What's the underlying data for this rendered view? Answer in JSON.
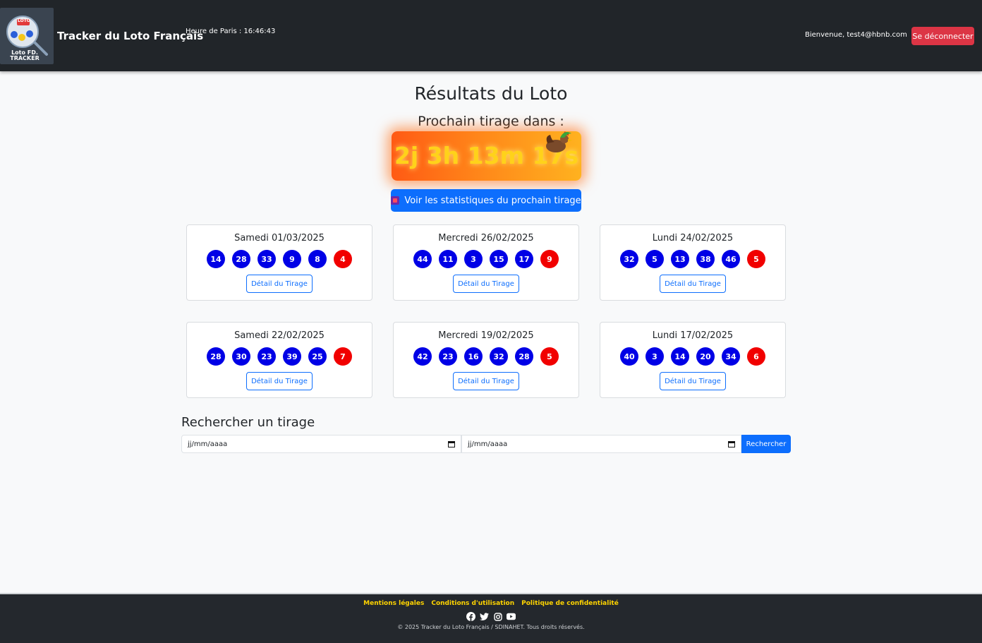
{
  "header": {
    "logo_text_top": "LOTO",
    "logo_text_bottom": "Loto FD. TRACKER",
    "brand": "Tracker du Loto Français",
    "clock": "Heure de Paris : 16:46:43",
    "welcome": "Bienvenue, test4@hbnb.com",
    "logout_label": "Se déconnecter"
  },
  "main": {
    "title": "Résultats du Loto",
    "subtitle": "Prochain tirage dans :",
    "countdown": "2j 3h 13m 17s",
    "stats_button": "Voir les statistiques du prochain tirage"
  },
  "draws": [
    {
      "date": "Samedi 01/03/2025",
      "numbers": [
        "14",
        "28",
        "33",
        "9",
        "8"
      ],
      "chance": "4",
      "detail_label": "Détail du Tirage"
    },
    {
      "date": "Mercredi 26/02/2025",
      "numbers": [
        "44",
        "11",
        "3",
        "15",
        "17"
      ],
      "chance": "9",
      "detail_label": "Détail du Tirage"
    },
    {
      "date": "Lundi 24/02/2025",
      "numbers": [
        "32",
        "5",
        "13",
        "38",
        "46"
      ],
      "chance": "5",
      "detail_label": "Détail du Tirage"
    },
    {
      "date": "Samedi 22/02/2025",
      "numbers": [
        "28",
        "30",
        "23",
        "39",
        "25"
      ],
      "chance": "7",
      "detail_label": "Détail du Tirage"
    },
    {
      "date": "Mercredi 19/02/2025",
      "numbers": [
        "42",
        "23",
        "16",
        "32",
        "28"
      ],
      "chance": "5",
      "detail_label": "Détail du Tirage"
    },
    {
      "date": "Lundi 17/02/2025",
      "numbers": [
        "40",
        "3",
        "14",
        "20",
        "34"
      ],
      "chance": "6",
      "detail_label": "Détail du Tirage"
    }
  ],
  "search": {
    "title": "Rechercher un tirage",
    "start_placeholder": "jj/mm/aaaa",
    "end_placeholder": "jj/mm/aaaa",
    "button_label": "Rechercher"
  },
  "footer": {
    "links": [
      "Mentions légales",
      "Conditions d'utilisation",
      "Politique de confidentialité"
    ],
    "social_icons": [
      "facebook-icon",
      "twitter-icon",
      "instagram-icon",
      "youtube-icon"
    ],
    "copyright": "© 2025 Tracker du Loto Français / SDINAHET. Tous droits réservés."
  },
  "colors": {
    "header_bg": "#212529",
    "primary": "#0d6efd",
    "danger": "#dc3545",
    "ball_blue": "#0000e6",
    "ball_red": "#f10000",
    "footer_link": "#ffd400",
    "countdown_text": "#ffd21a"
  }
}
